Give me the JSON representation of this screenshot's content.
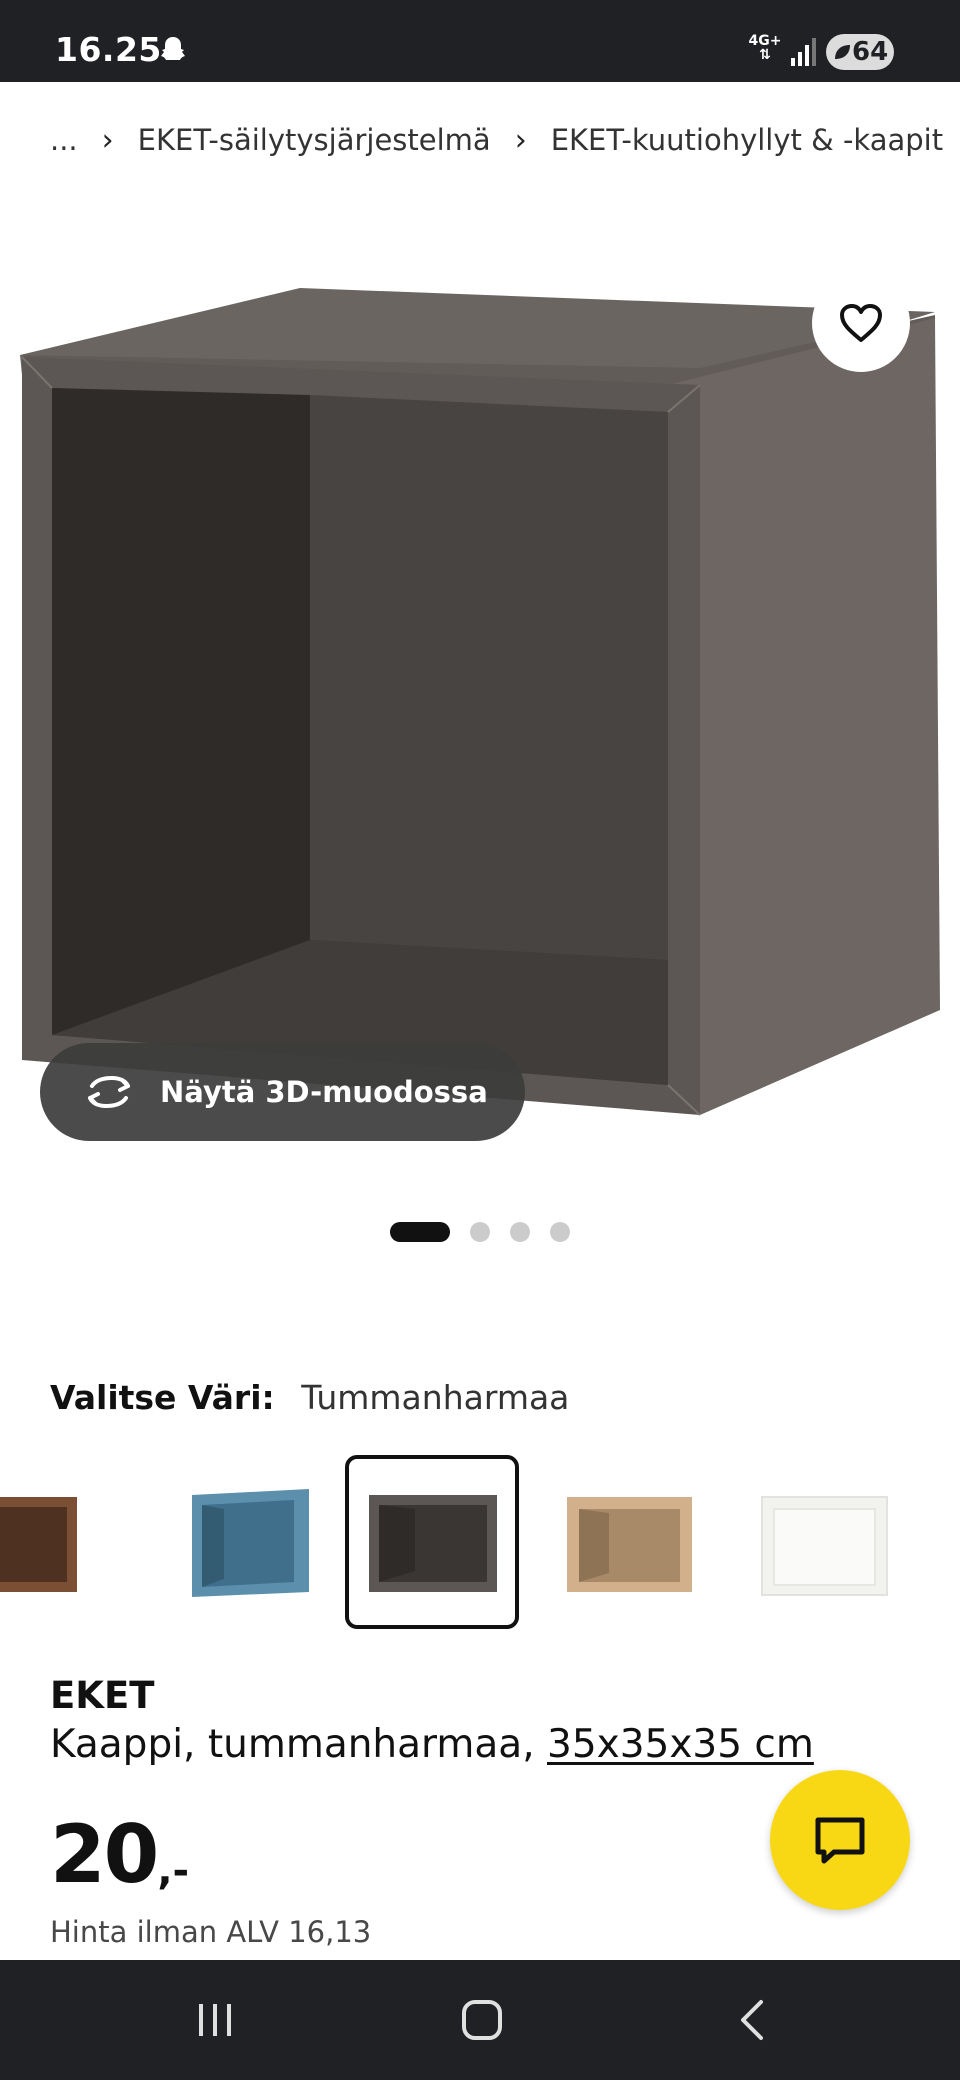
{
  "status_bar": {
    "time": "16.25",
    "network": "4G+",
    "battery": "64"
  },
  "breadcrumb": {
    "ellipsis": "...",
    "items": [
      "EKET-säilytysjärjestelmä",
      "EKET-kuutiohyllyt & -kaapit"
    ]
  },
  "product_image": {
    "view_3d_label": "Näytä 3D-muodossa",
    "carousel_count": 4,
    "carousel_active": 1
  },
  "color_selector": {
    "title": "Valitse Väri:",
    "selected": "Tummanharmaa",
    "swatch_colors": [
      "#7a4f34",
      "#4f7f9a",
      "#4a4744",
      "#c9a985",
      "#f2f2ef"
    ]
  },
  "product": {
    "name": "EKET",
    "description": "Kaappi, tummanharmaa,",
    "size": "35x35x35 cm",
    "price": "20",
    "price_suffix": ",-",
    "price_ex_vat": "Hinta ilman ALV 16,13"
  },
  "colors": {
    "accent_yellow": "#f8d815",
    "system_bar": "#202125"
  },
  "icons": {
    "favorite": "heart-icon",
    "view_3d": "rotate-icon",
    "chat": "chat-bubble-icon"
  }
}
